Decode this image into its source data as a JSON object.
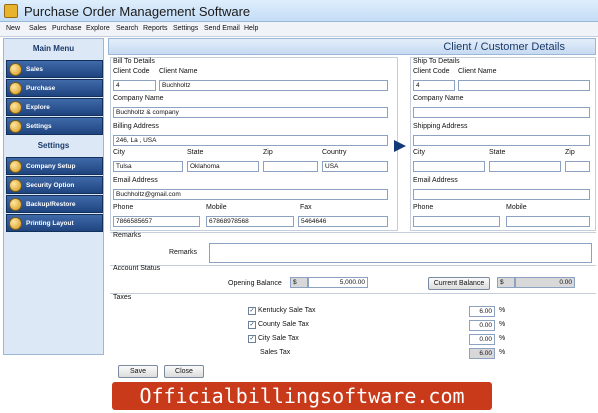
{
  "app": {
    "title": "Purchase Order Management Software"
  },
  "menu": [
    "New",
    "Sales",
    "Purchase",
    "Explore",
    "Search",
    "Reports",
    "Settings",
    "Send Email",
    "Help"
  ],
  "sidebar": {
    "main_title": "Main Menu",
    "main_items": [
      {
        "label": "Sales",
        "icon": "coins-icon"
      },
      {
        "label": "Purchase",
        "icon": "coins-icon"
      },
      {
        "label": "Explore",
        "icon": "folder-icon"
      },
      {
        "label": "Settings",
        "icon": "gear-icon"
      }
    ],
    "settings_title": "Settings",
    "settings_items": [
      {
        "label": "Company Setup",
        "icon": "gear-icon"
      },
      {
        "label": "Security Option",
        "icon": "lock-icon"
      },
      {
        "label": "Backup/Restore",
        "icon": "disk-icon"
      },
      {
        "label": "Printing Layout",
        "icon": "printer-icon"
      }
    ]
  },
  "form": {
    "header": "Client / Customer Details",
    "bill": {
      "section": "Bill To Details",
      "client_code_label": "Client Code",
      "client_name_label": "Client Name",
      "client_code": "4",
      "client_name": "Buchholtz",
      "company_name_label": "Company Name",
      "company_name": "Buchholtz & company",
      "address_label": "Billing Address",
      "address": "246, La , USA",
      "city_label": "City",
      "state_label": "State",
      "zip_label": "Zip",
      "country_label": "Country",
      "city": "Tulsa",
      "state": "Oklahoma",
      "zip": "",
      "country": "USA",
      "email_label": "Email Address",
      "email": "Buchholtz@gmail.com",
      "phone_label": "Phone",
      "mobile_label": "Mobile",
      "fax_label": "Fax",
      "phone": "7866585657",
      "mobile": "67868978568",
      "fax": "5464646"
    },
    "ship": {
      "section": "Ship To Details",
      "client_code_label": "Client Code",
      "client_name_label": "Client Name",
      "client_code": "4",
      "client_name": "",
      "company_name_label": "Company Name",
      "company_name": "",
      "address_label": "Shipping Address",
      "address": "",
      "city_label": "City",
      "state_label": "State",
      "zip_label": "Zip",
      "city": "",
      "state": "",
      "zip": "",
      "email_label": "Email Address",
      "email": "",
      "phone_label": "Phone",
      "mobile_label": "Mobile",
      "phone": "",
      "mobile": ""
    },
    "remarks": {
      "section": "Remarks",
      "label": "Remarks",
      "value": ""
    },
    "account": {
      "section": "Account Status",
      "opening_label": "Opening Balance",
      "currency": "$",
      "opening_value": "5,000.00",
      "current_label": "Current Balance",
      "current_value": "0.00"
    },
    "taxes": {
      "section": "Taxes",
      "items": [
        {
          "label": "Kentucky Sale Tax",
          "value": "6.00",
          "unit": "%",
          "checked": "✓"
        },
        {
          "label": "County Sale Tax",
          "value": "0.00",
          "unit": "%",
          "checked": "✓"
        },
        {
          "label": "City Sale Tax",
          "value": "0.00",
          "unit": "%",
          "checked": "✓"
        }
      ],
      "sales_tax_label": "Sales Tax",
      "sales_tax_value": "6.00",
      "sales_tax_unit": "%"
    },
    "buttons": {
      "save": "Save",
      "close": "Close"
    }
  },
  "banner": "Officialbillingsoftware.com"
}
